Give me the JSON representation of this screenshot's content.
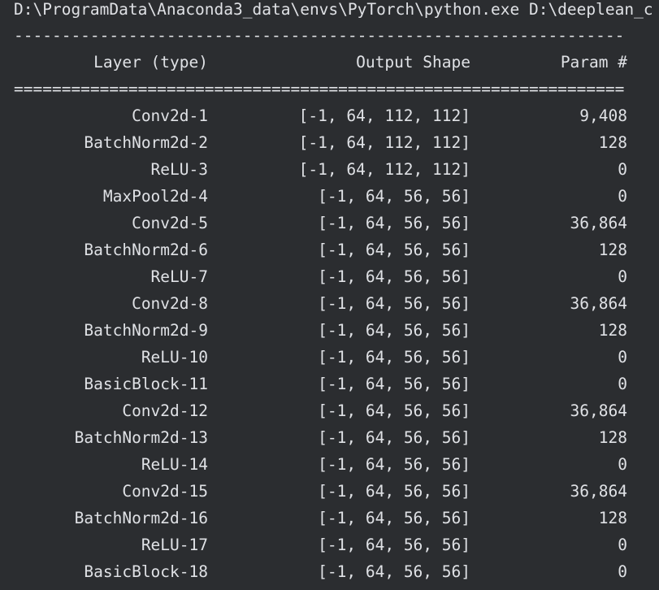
{
  "command": "D:\\ProgramData\\Anaconda3_data\\envs\\PyTorch\\python.exe D:\\deeplean_c",
  "separator_dash": "----------------------------------------------------------------",
  "separator_eq": "================================================================",
  "header": {
    "layer": "Layer (type)",
    "shape": "Output Shape",
    "param": "Param #"
  },
  "rows": [
    {
      "layer": "Conv2d-1",
      "shape": "[-1, 64, 112, 112]",
      "param": "9,408"
    },
    {
      "layer": "BatchNorm2d-2",
      "shape": "[-1, 64, 112, 112]",
      "param": "128"
    },
    {
      "layer": "ReLU-3",
      "shape": "[-1, 64, 112, 112]",
      "param": "0"
    },
    {
      "layer": "MaxPool2d-4",
      "shape": "[-1, 64, 56, 56]",
      "param": "0"
    },
    {
      "layer": "Conv2d-5",
      "shape": "[-1, 64, 56, 56]",
      "param": "36,864"
    },
    {
      "layer": "BatchNorm2d-6",
      "shape": "[-1, 64, 56, 56]",
      "param": "128"
    },
    {
      "layer": "ReLU-7",
      "shape": "[-1, 64, 56, 56]",
      "param": "0"
    },
    {
      "layer": "Conv2d-8",
      "shape": "[-1, 64, 56, 56]",
      "param": "36,864"
    },
    {
      "layer": "BatchNorm2d-9",
      "shape": "[-1, 64, 56, 56]",
      "param": "128"
    },
    {
      "layer": "ReLU-10",
      "shape": "[-1, 64, 56, 56]",
      "param": "0"
    },
    {
      "layer": "BasicBlock-11",
      "shape": "[-1, 64, 56, 56]",
      "param": "0"
    },
    {
      "layer": "Conv2d-12",
      "shape": "[-1, 64, 56, 56]",
      "param": "36,864"
    },
    {
      "layer": "BatchNorm2d-13",
      "shape": "[-1, 64, 56, 56]",
      "param": "128"
    },
    {
      "layer": "ReLU-14",
      "shape": "[-1, 64, 56, 56]",
      "param": "0"
    },
    {
      "layer": "Conv2d-15",
      "shape": "[-1, 64, 56, 56]",
      "param": "36,864"
    },
    {
      "layer": "BatchNorm2d-16",
      "shape": "[-1, 64, 56, 56]",
      "param": "128"
    },
    {
      "layer": "ReLU-17",
      "shape": "[-1, 64, 56, 56]",
      "param": "0"
    },
    {
      "layer": "BasicBlock-18",
      "shape": "[-1, 64, 56, 56]",
      "param": "0"
    }
  ],
  "colors": {
    "background": "#2b2d30",
    "text": "#dfe1e5"
  }
}
